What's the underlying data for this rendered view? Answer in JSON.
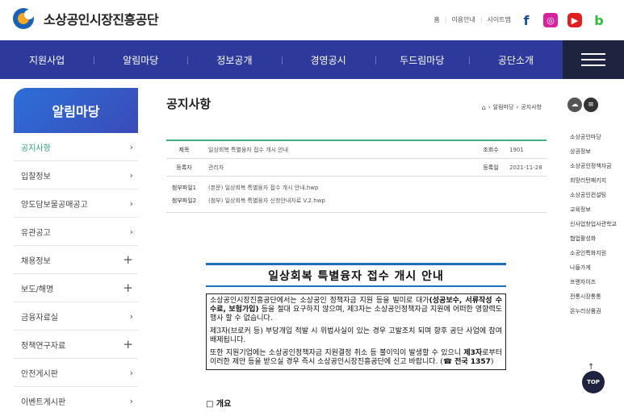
{
  "header": {
    "logo_text": "소상공인시장진흥공단",
    "util_links": [
      "홈",
      "이용안내",
      "사이트맵"
    ],
    "sns": [
      "facebook-icon",
      "instagram-icon",
      "youtube-icon",
      "blog-icon"
    ]
  },
  "gnb": [
    "지원사업",
    "알림마당",
    "정보공개",
    "경영공시",
    "두드림마당",
    "공단소개"
  ],
  "lnb": {
    "title": "알림마당",
    "items": [
      {
        "label": "공지사항",
        "mark": "›",
        "active": true
      },
      {
        "label": "입찰정보",
        "mark": "›"
      },
      {
        "label": "양도담보물공매공고",
        "mark": "›"
      },
      {
        "label": "유관공고",
        "mark": "›"
      },
      {
        "label": "채용정보",
        "mark": "+"
      },
      {
        "label": "보도/해명",
        "mark": "+"
      },
      {
        "label": "금융자료실",
        "mark": "›"
      },
      {
        "label": "정책연구자료",
        "mark": "+"
      },
      {
        "label": "안전게시판",
        "mark": "›"
      },
      {
        "label": "이벤트게시판",
        "mark": "›"
      }
    ]
  },
  "content": {
    "page_title": "공지사항",
    "breadcrumb": [
      "알림마당",
      "공지사항"
    ],
    "view": {
      "title_label": "제목",
      "title_value": "일상회복 특별융자 접수 개시 안내",
      "views_label": "조회수",
      "views_value": "1901",
      "author_label": "등록자",
      "author_value": "관리자",
      "date_label": "등록일",
      "date_value": "2021-11-28",
      "files": [
        {
          "label": "첨부파일1",
          "name": "(본문) 일상회복 특별융자 접수 개시 안내.hwp"
        },
        {
          "label": "첨부파일2",
          "name": "(첨부) 일상회복 특별융자 신청안내자료 V.2.hwp"
        }
      ]
    },
    "notice": {
      "title": "일상회복 특별융자 접수 개시 안내",
      "p1_a": "소상공인시장진흥공단에서는 소상공인 정책자금 지원 등을 빌미로 대가",
      "p1_b": "(성공보수, 서류작성 수수료, 보험가입)",
      "p1_c": " 등을 절대 요구하지 않으며, 제3자는 소상공인정책자금 지원에 어떠한 영향력도 행사 할 수 없습니다.",
      "p2": "제3자(브로커 등) 부당개입 적발 시 위법사실이 있는 경우 고발조치 되며 향후 공단 사업에 참여 배제됩니다.",
      "p3_a": "또한 지원기업에는 소상공인정책자금 지원결정 취소 등 불이익이 발생할 수 있으니 ",
      "p3_b": "제3자",
      "p3_c": "로부터 이러한 제안 등을 받으실 경우 즉시 소상공인시장진흥공단에 신고 바랍니다. (",
      "p3_phone": "☎ 전국 1357",
      "p3_d": ")",
      "overview": "□ 개요"
    }
  },
  "quick": {
    "items": [
      "소상공인마당",
      "상권정보",
      "소상공인정책자금",
      "희망리턴패키지",
      "소상공인컨설팅",
      "교육정보",
      "신사업창업사관학교",
      "협업활성화",
      "소공인특화지원",
      "나들가게",
      "프랜차이즈",
      "전통시장통통",
      "온누리상품권"
    ],
    "top_label": "TOP"
  }
}
